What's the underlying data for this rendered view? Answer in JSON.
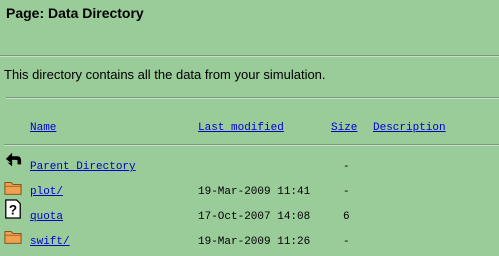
{
  "page": {
    "title": "Page: Data Directory",
    "intro": "This directory contains all the data from your simulation."
  },
  "listing": {
    "headers": {
      "name": "Name",
      "modified": "Last modified",
      "size": "Size",
      "description": "Description"
    },
    "rows": [
      {
        "icon": "back-arrow-icon",
        "name": "Parent Directory",
        "modified": "",
        "size": "-"
      },
      {
        "icon": "folder-icon",
        "name": "plot/",
        "modified": "19-Mar-2009 11:41",
        "size": "-"
      },
      {
        "icon": "unknown-file-icon",
        "name": "quota",
        "modified": "17-Oct-2007 14:08",
        "size": "6"
      },
      {
        "icon": "folder-icon",
        "name": "swift/",
        "modified": "19-Mar-2009 11:26",
        "size": "-"
      }
    ]
  },
  "colors": {
    "background": "#99cc99",
    "link": "#0000cc",
    "folder": "#f0a050"
  }
}
